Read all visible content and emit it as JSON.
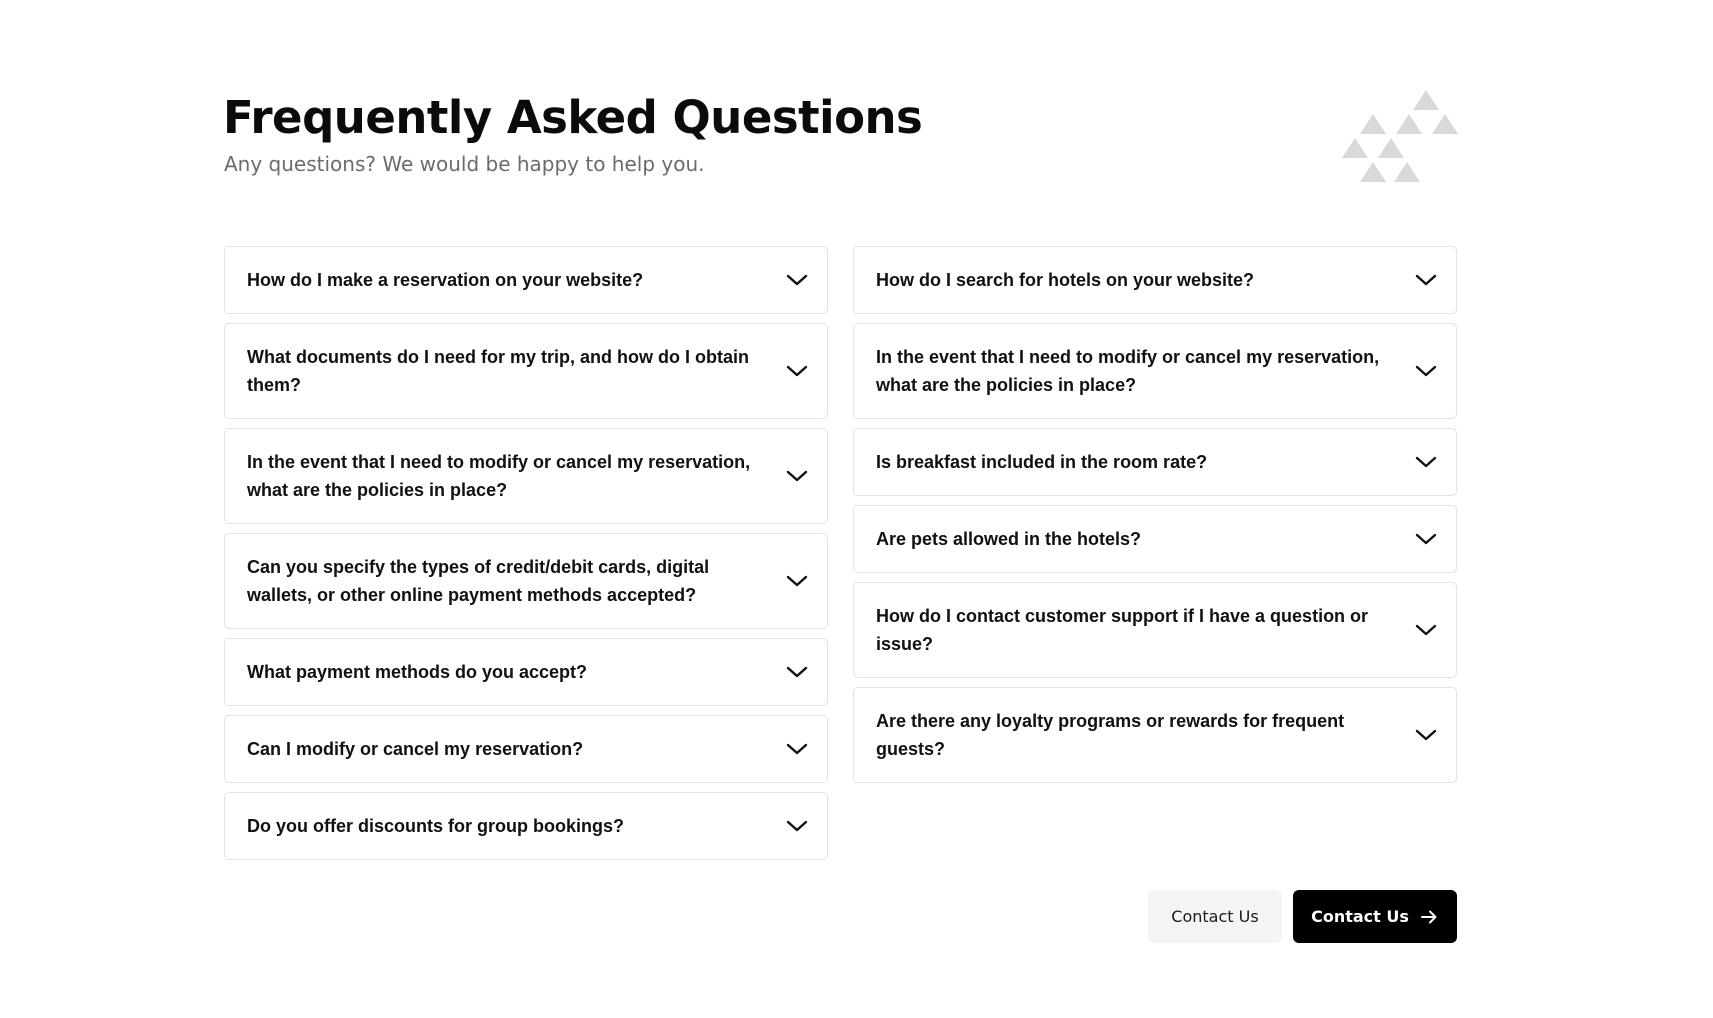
{
  "header": {
    "title": "Frequently Asked Questions",
    "subtitle": "Any questions? We would be happy to help you."
  },
  "faq": {
    "left": [
      {
        "question": "How do I make a reservation on your website?"
      },
      {
        "question": "What documents do I need for my trip, and how do I obtain them?"
      },
      {
        "question": "In the event that I need to modify or cancel my reservation, what are the policies in place?"
      },
      {
        "question": "Can you specify the types of credit/debit cards, digital wallets, or other online payment methods accepted?"
      },
      {
        "question": "What payment methods do you accept?"
      },
      {
        "question": "Can I modify or cancel my reservation?"
      },
      {
        "question": "Do you offer discounts for group bookings?"
      }
    ],
    "right": [
      {
        "question": "How do I search for hotels on your website?"
      },
      {
        "question": "In the event that I need to modify or cancel my reservation, what are the policies in place?"
      },
      {
        "question": "Is breakfast included in the room rate?"
      },
      {
        "question": "Are pets allowed in the hotels?"
      },
      {
        "question": "How do I contact customer support if I have a question or issue?"
      },
      {
        "question": "Are there any loyalty programs or rewards for frequent guests?"
      }
    ],
    "toggle_icon": "chevron-down-icon"
  },
  "actions": {
    "secondary_label": "Contact Us",
    "primary_label": "Contact Us",
    "primary_icon": "arrow-right-icon"
  },
  "colors": {
    "primary_button": "#000000",
    "secondary_button": "#f3f4f6",
    "card_border": "#e3e3e3",
    "decor_triangles": "#d9d9d9"
  }
}
